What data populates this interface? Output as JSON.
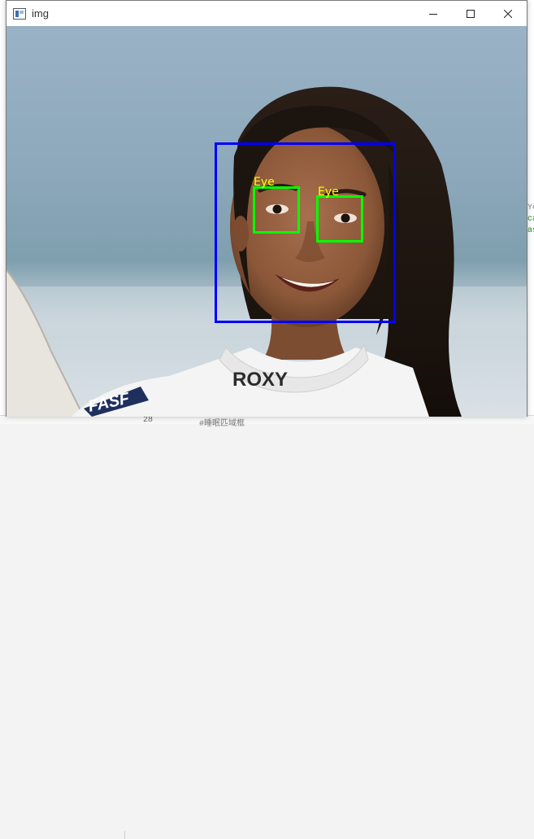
{
  "window": {
    "title": "img",
    "controls": {
      "minimize_icon": "minimize-icon",
      "maximize_icon": "maximize-icon",
      "close_icon": "close-icon"
    }
  },
  "background_app": {
    "line_number": "28",
    "comment": "#睡眠匹域框",
    "edge_marks": [
      "Yo",
      "ca",
      "as"
    ]
  },
  "detections": {
    "face": {
      "color": "#0000ff"
    },
    "eyes": [
      {
        "label": "Eye",
        "color": "#00ff00",
        "label_color": "#ffff00"
      },
      {
        "label": "Eye",
        "color": "#00ff00",
        "label_color": "#ffff00"
      }
    ]
  },
  "image": {
    "shirt_text": "ROXY",
    "logo_text": "FASF"
  }
}
